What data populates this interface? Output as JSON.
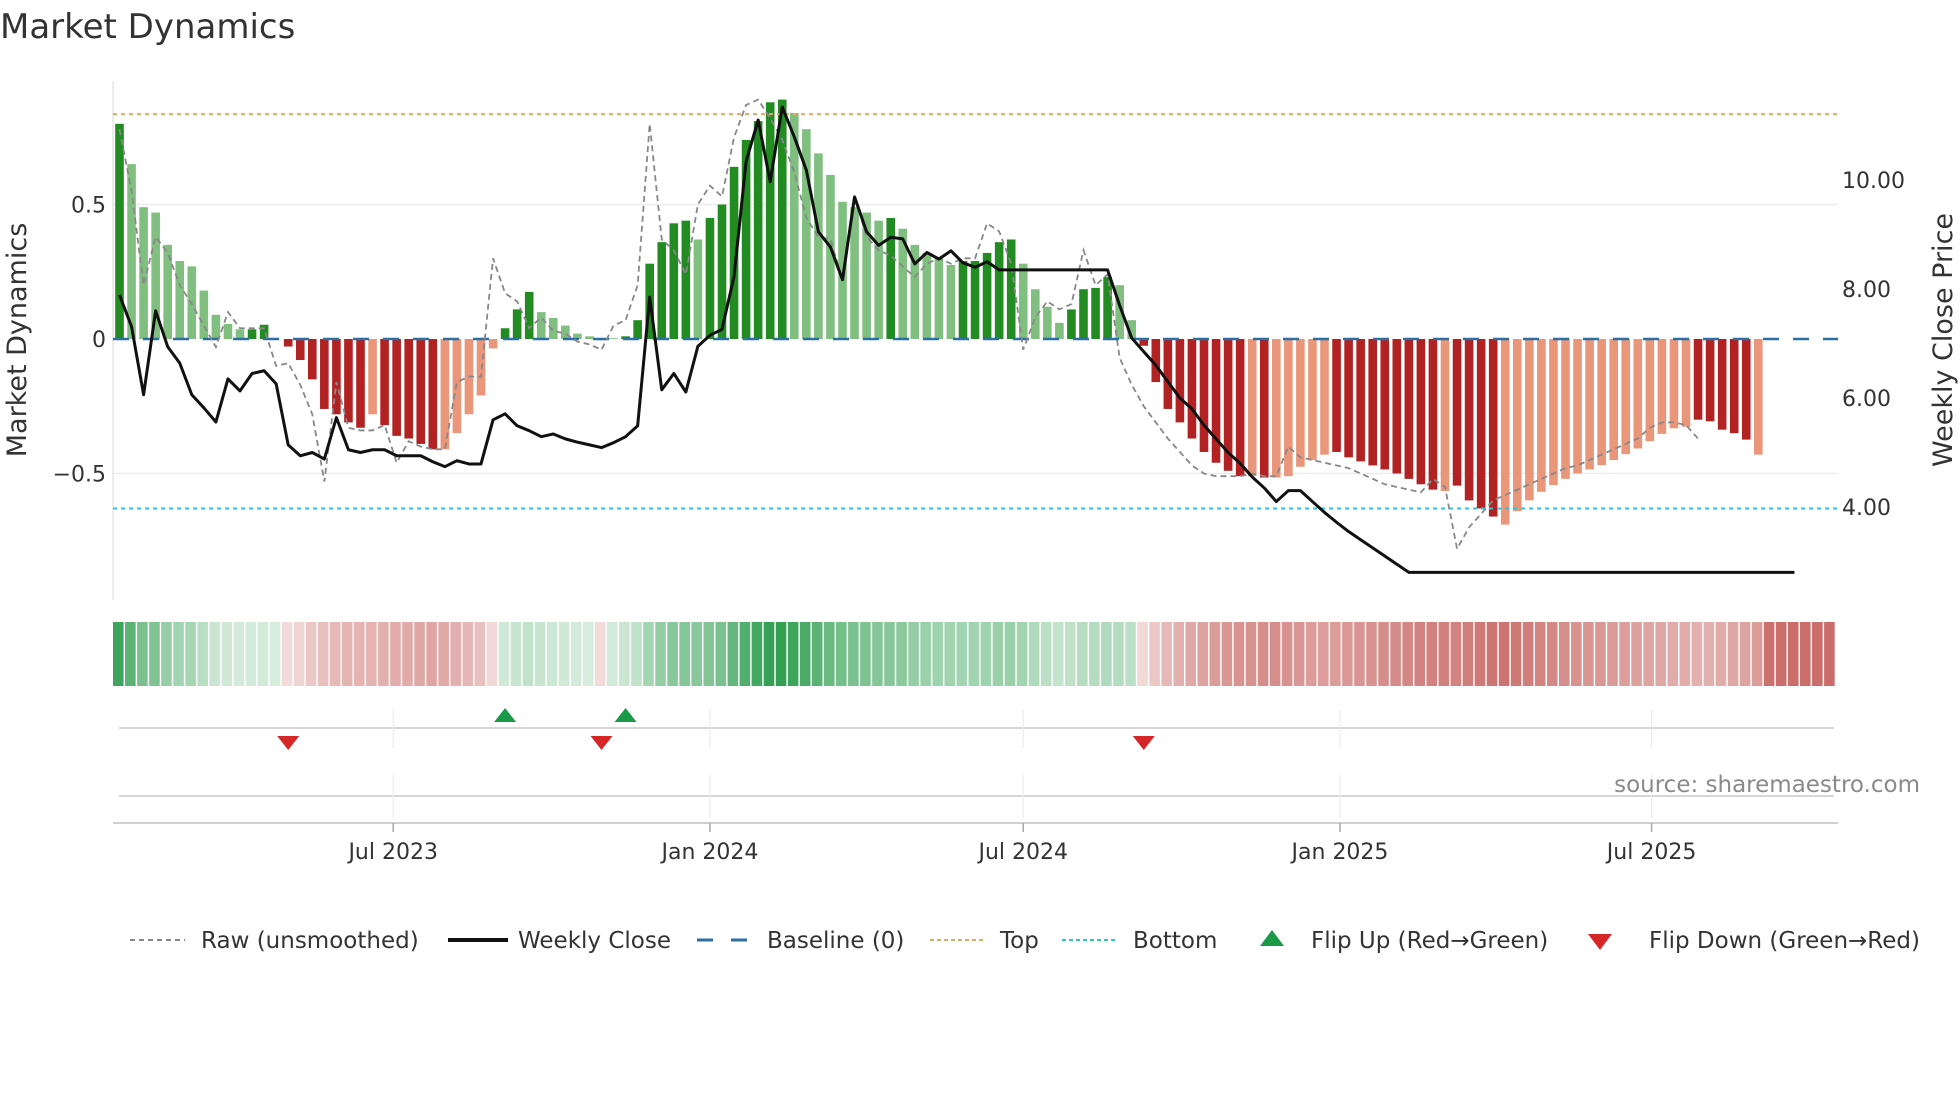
{
  "chart_data": {
    "type": "bar",
    "title": "Market Dynamics",
    "ylabel_left": "Market Dynamics",
    "ylabel_right": "Weekly Close Price",
    "source": "source: sharemaestro.com",
    "start_date": "2023-01-23",
    "frequency": "weekly",
    "ylim_left": [
      -1.0,
      0.95
    ],
    "ylim_right": [
      2.0,
      12.0
    ],
    "left_ticks": [
      {
        "value": 0.5,
        "label": "0.5"
      },
      {
        "value": 0,
        "label": "0"
      },
      {
        "value": -0.5,
        "label": "−0.5"
      }
    ],
    "right_ticks": [
      {
        "value": 10,
        "label": "10.00"
      },
      {
        "value": 8,
        "label": "8.00"
      },
      {
        "value": 6,
        "label": "6.00"
      },
      {
        "value": 4,
        "label": "4.00"
      }
    ],
    "x_ticks": [
      {
        "date": "2023-07-01",
        "label": "Jul 2023"
      },
      {
        "date": "2024-01-01",
        "label": "Jan 2024"
      },
      {
        "date": "2024-07-01",
        "label": "Jul 2024"
      },
      {
        "date": "2025-01-01",
        "label": "Jan 2025"
      },
      {
        "date": "2025-07-01",
        "label": "Jul 2025"
      }
    ],
    "top_threshold": 0.836,
    "bottom_threshold": -0.63,
    "baseline": 0,
    "dynamics": [
      0.8,
      0.65,
      0.49,
      0.47,
      0.35,
      0.29,
      0.27,
      0.18,
      0.09,
      0.056,
      0.036,
      0.036,
      0.053,
      0.0,
      -0.028,
      -0.078,
      -0.15,
      -0.26,
      -0.28,
      -0.31,
      -0.33,
      -0.28,
      -0.32,
      -0.36,
      -0.37,
      -0.39,
      -0.41,
      -0.41,
      -0.35,
      -0.28,
      -0.21,
      -0.035,
      0.04,
      0.11,
      0.175,
      0.1,
      0.078,
      0.05,
      0.02,
      0.01,
      -0.005,
      0.003,
      0.01,
      0.07,
      0.28,
      0.36,
      0.43,
      0.44,
      0.37,
      0.45,
      0.5,
      0.64,
      0.74,
      0.81,
      0.88,
      0.89,
      0.84,
      0.78,
      0.69,
      0.61,
      0.51,
      0.49,
      0.47,
      0.44,
      0.45,
      0.41,
      0.35,
      0.32,
      0.3,
      0.275,
      0.29,
      0.29,
      0.32,
      0.36,
      0.37,
      0.28,
      0.185,
      0.12,
      0.06,
      0.11,
      0.185,
      0.19,
      0.23,
      0.2,
      0.07,
      -0.025,
      -0.16,
      -0.26,
      -0.31,
      -0.37,
      -0.42,
      -0.46,
      -0.49,
      -0.51,
      -0.51,
      -0.515,
      -0.515,
      -0.51,
      -0.475,
      -0.45,
      -0.43,
      -0.42,
      -0.44,
      -0.455,
      -0.47,
      -0.485,
      -0.5,
      -0.52,
      -0.54,
      -0.56,
      -0.565,
      -0.545,
      -0.6,
      -0.63,
      -0.66,
      -0.69,
      -0.64,
      -0.6,
      -0.568,
      -0.543,
      -0.52,
      -0.5,
      -0.485,
      -0.469,
      -0.45,
      -0.428,
      -0.407,
      -0.38,
      -0.353,
      -0.332,
      -0.326,
      -0.3,
      -0.306,
      -0.337,
      -0.35,
      -0.374,
      -0.43
    ],
    "strong": "DLLLLLLLLLLDDLDDDDDDDLDDDDDLLLLLDDDLLLLLLLDDDDDDLDDDDDDDLLLLLLLLDLLLLLDDDDDLLLLDDDDLLDDDDDDDDDLDLLLLLDDDDDDDDDLDDDDLLLLLLLLLLLLLLLLDDDDD",
    "raw": [
      0.78,
      0.55,
      0.2,
      0.38,
      0.32,
      0.2,
      0.13,
      0.05,
      -0.03,
      0.1,
      0.04,
      0.04,
      0.04,
      -0.1,
      -0.09,
      -0.17,
      -0.28,
      -0.53,
      -0.16,
      -0.33,
      -0.34,
      -0.34,
      -0.32,
      -0.46,
      -0.38,
      -0.4,
      -0.41,
      -0.41,
      -0.16,
      -0.14,
      -0.14,
      0.3,
      0.17,
      0.14,
      0.04,
      0.08,
      0.03,
      0.02,
      -0.01,
      -0.02,
      -0.04,
      0.05,
      0.07,
      0.2,
      0.8,
      0.37,
      0.33,
      0.24,
      0.5,
      0.57,
      0.53,
      0.75,
      0.87,
      0.89,
      0.82,
      0.74,
      0.62,
      0.45,
      0.38,
      0.37,
      0.22,
      0.53,
      0.38,
      0.33,
      0.31,
      0.27,
      0.23,
      0.28,
      0.3,
      0.28,
      0.3,
      0.3,
      0.43,
      0.4,
      0.28,
      -0.04,
      0.08,
      0.14,
      0.11,
      0.13,
      0.33,
      0.2,
      0.24,
      -0.07,
      -0.17,
      -0.25,
      -0.31,
      -0.37,
      -0.42,
      -0.47,
      -0.5,
      -0.51,
      -0.51,
      -0.51,
      -0.5,
      -0.51,
      -0.51,
      -0.4,
      -0.44,
      -0.45,
      -0.46,
      -0.47,
      -0.48,
      -0.5,
      -0.52,
      -0.54,
      -0.55,
      -0.56,
      -0.57,
      -0.52,
      -0.55,
      -0.78,
      -0.7,
      -0.65,
      -0.6,
      -0.58,
      -0.56,
      -0.54,
      -0.52,
      -0.5,
      -0.48,
      -0.47,
      -0.45,
      -0.43,
      -0.41,
      -0.39,
      -0.37,
      -0.33,
      -0.31,
      -0.31,
      -0.32,
      -0.37
    ],
    "weekly_close": [
      7.89,
      7.31,
      6.06,
      7.6,
      6.94,
      6.64,
      6.06,
      5.82,
      5.56,
      6.35,
      6.13,
      6.45,
      6.5,
      6.26,
      5.14,
      4.94,
      5.0,
      4.88,
      5.64,
      5.05,
      5.0,
      5.05,
      5.05,
      4.94,
      4.94,
      4.94,
      4.83,
      4.74,
      4.85,
      4.79,
      4.79,
      5.6,
      5.71,
      5.49,
      5.4,
      5.29,
      5.34,
      5.25,
      5.19,
      5.14,
      5.09,
      5.18,
      5.29,
      5.49,
      7.85,
      6.15,
      6.45,
      6.11,
      6.95,
      7.15,
      7.26,
      8.23,
      10.34,
      11.1,
      9.97,
      11.34,
      10.79,
      10.18,
      9.05,
      8.77,
      8.17,
      9.69,
      9.05,
      8.8,
      8.95,
      8.92,
      8.46,
      8.67,
      8.55,
      8.7,
      8.48,
      8.4,
      8.5,
      8.35,
      8.35,
      8.35,
      8.35,
      8.35,
      8.35,
      8.35,
      8.35,
      8.35,
      8.35,
      7.7,
      7.1,
      6.85,
      6.6,
      6.3,
      6.0,
      5.8,
      5.5,
      5.25,
      5.0,
      4.8,
      4.55,
      4.35,
      4.1,
      4.3,
      4.3,
      4.1,
      3.9,
      3.72,
      3.55,
      3.4,
      3.25,
      3.1,
      2.95,
      2.8,
      2.8,
      2.8,
      2.8,
      2.8,
      2.8,
      2.8,
      2.8,
      2.8,
      2.8,
      2.8,
      2.8,
      2.8,
      2.8,
      2.8,
      2.8,
      2.8,
      2.8,
      2.8,
      2.8,
      2.8,
      2.8,
      2.8,
      2.8,
      2.8,
      2.8,
      2.8,
      2.8,
      2.8,
      2.8,
      2.8,
      2.8,
      2.8
    ],
    "strip_values": [
      0.8,
      0.65,
      0.49,
      0.47,
      0.35,
      0.29,
      0.27,
      0.18,
      0.09,
      0.06,
      0.04,
      0.04,
      0.05,
      0.03,
      -0.04,
      -0.08,
      -0.15,
      -0.2,
      -0.24,
      -0.27,
      -0.28,
      -0.28,
      -0.3,
      -0.32,
      -0.33,
      -0.35,
      -0.36,
      -0.34,
      -0.3,
      -0.25,
      -0.2,
      -0.05,
      0.06,
      0.1,
      0.14,
      0.1,
      0.08,
      0.06,
      0.04,
      0.03,
      -0.04,
      0.05,
      0.09,
      0.14,
      0.28,
      0.36,
      0.43,
      0.44,
      0.42,
      0.45,
      0.5,
      0.6,
      0.7,
      0.78,
      0.84,
      0.86,
      0.8,
      0.74,
      0.66,
      0.58,
      0.52,
      0.49,
      0.47,
      0.44,
      0.43,
      0.41,
      0.36,
      0.33,
      0.31,
      0.29,
      0.29,
      0.29,
      0.31,
      0.33,
      0.34,
      0.29,
      0.22,
      0.16,
      0.13,
      0.15,
      0.19,
      0.2,
      0.22,
      0.2,
      0.16,
      -0.05,
      -0.16,
      -0.24,
      -0.3,
      -0.34,
      -0.38,
      -0.42,
      -0.45,
      -0.47,
      -0.48,
      -0.5,
      -0.5,
      -0.48,
      -0.45,
      -0.42,
      -0.41,
      -0.42,
      -0.44,
      -0.46,
      -0.48,
      -0.5,
      -0.52,
      -0.55,
      -0.57,
      -0.58,
      -0.58,
      -0.56,
      -0.6,
      -0.63,
      -0.65,
      -0.66,
      -0.63,
      -0.6,
      -0.56,
      -0.53,
      -0.5,
      -0.48,
      -0.46,
      -0.45,
      -0.43,
      -0.41,
      -0.39,
      -0.37,
      -0.35,
      -0.33,
      -0.32,
      -0.3,
      -0.3,
      -0.33,
      -0.35,
      -0.37,
      -0.42,
      -0.68,
      -0.7,
      -0.7,
      -0.7,
      -0.7,
      -0.7
    ],
    "flip_up": [
      32,
      42
    ],
    "flip_down": [
      14,
      40,
      85
    ],
    "legend": {
      "position": "bottom",
      "items": [
        {
          "key": "raw",
          "label": "Raw (unsmoothed)"
        },
        {
          "key": "close",
          "label": "Weekly Close"
        },
        {
          "key": "baseline",
          "label": "Baseline (0)"
        },
        {
          "key": "top",
          "label": "Top"
        },
        {
          "key": "bottom",
          "label": "Bottom"
        },
        {
          "key": "up",
          "label": "Flip Up (Red→Green)"
        },
        {
          "key": "down",
          "label": "Flip Down (Green→Red)"
        }
      ]
    },
    "colors": {
      "green_strong": "#228b22",
      "green_weak": "#80bf80",
      "red_strong": "#b22222",
      "red_weak": "#e9967a",
      "top": "#e8a865",
      "bottom": "#2ec4d6",
      "baseline": "#2b6fa3",
      "raw": "#888888",
      "close": "#111111",
      "flip_up": "#1a9a48",
      "flip_down": "#d62728",
      "strip_green": "#2f9e50",
      "strip_red": "#c0504d"
    }
  }
}
